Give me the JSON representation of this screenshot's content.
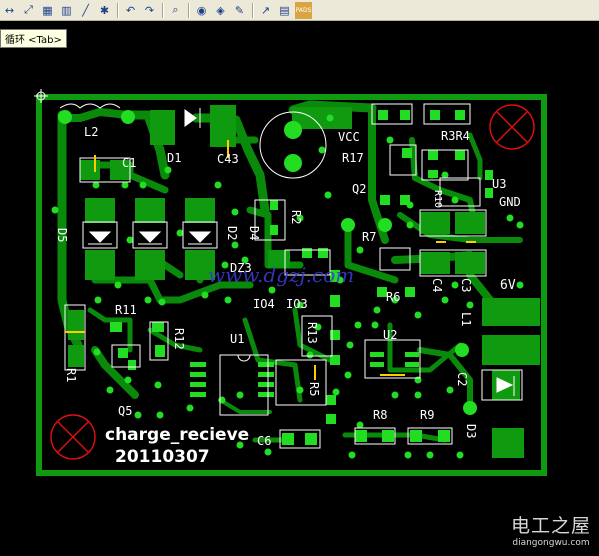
{
  "toolbar": {
    "buttons": [
      {
        "id": "toolbar-button-pan",
        "glyph": "↔"
      },
      {
        "id": "toolbar-button-route",
        "glyph": "⤢"
      },
      {
        "id": "toolbar-button-fill",
        "glyph": "▦"
      },
      {
        "id": "toolbar-button-component",
        "glyph": "▥"
      },
      {
        "id": "toolbar-button-line",
        "glyph": "╱"
      },
      {
        "id": "toolbar-button-via",
        "glyph": "✱"
      },
      {
        "id": "toolbar-button-undo",
        "glyph": "↶"
      },
      {
        "id": "toolbar-button-redo",
        "glyph": "↷"
      },
      {
        "id": "toolbar-button-zoom",
        "glyph": "⌕"
      },
      {
        "id": "toolbar-button-view",
        "glyph": "◉"
      },
      {
        "id": "toolbar-button-highlight",
        "glyph": "◈"
      },
      {
        "id": "toolbar-button-paint",
        "glyph": "✎"
      },
      {
        "id": "toolbar-button-open",
        "glyph": "↗"
      },
      {
        "id": "toolbar-button-layers",
        "glyph": "▤"
      },
      {
        "id": "toolbar-button-pads",
        "glyph": "PADS"
      }
    ]
  },
  "tooltip": {
    "text": "循环 <Tab>"
  },
  "board": {
    "refdes": [
      {
        "id": "L2",
        "text": "L2"
      },
      {
        "id": "C1",
        "text": "C1"
      },
      {
        "id": "D1",
        "text": "D1"
      },
      {
        "id": "C43",
        "text": "C43"
      },
      {
        "id": "VCC",
        "text": "VCC"
      },
      {
        "id": "R17",
        "text": "R17"
      },
      {
        "id": "R3R4",
        "text": "R3R4"
      },
      {
        "id": "Q2",
        "text": "Q2"
      },
      {
        "id": "R10",
        "text": "R10"
      },
      {
        "id": "U3",
        "text": "U3"
      },
      {
        "id": "GND",
        "text": "GND"
      },
      {
        "id": "D5",
        "text": "D5"
      },
      {
        "id": "D2",
        "text": "D2"
      },
      {
        "id": "D4",
        "text": "D4"
      },
      {
        "id": "R2",
        "text": "R2"
      },
      {
        "id": "R7",
        "text": "R7"
      },
      {
        "id": "DZ3",
        "text": "DZ3"
      },
      {
        "id": "C4",
        "text": "C4"
      },
      {
        "id": "C3",
        "text": "C3"
      },
      {
        "id": "6V",
        "text": "6V"
      },
      {
        "id": "R6",
        "text": "R6"
      },
      {
        "id": "R11",
        "text": "R11"
      },
      {
        "id": "R12",
        "text": "R12"
      },
      {
        "id": "IO4",
        "text": "IO4"
      },
      {
        "id": "IO3",
        "text": "IO3"
      },
      {
        "id": "L1",
        "text": "L1"
      },
      {
        "id": "U2",
        "text": "U2"
      },
      {
        "id": "R13",
        "text": "R13"
      },
      {
        "id": "U1",
        "text": "U1"
      },
      {
        "id": "R1",
        "text": "R1"
      },
      {
        "id": "R5",
        "text": "R5"
      },
      {
        "id": "C2",
        "text": "C2"
      },
      {
        "id": "Q5",
        "text": "Q5"
      },
      {
        "id": "R8",
        "text": "R8"
      },
      {
        "id": "R9",
        "text": "R9"
      },
      {
        "id": "D3",
        "text": "D3"
      },
      {
        "id": "C6",
        "text": "C6"
      }
    ],
    "silk_title": "charge_recieve",
    "silk_date": "20110307",
    "overlay_watermark": "www.dgzj.com"
  },
  "watermark": {
    "zh": "电工之屋",
    "en": "diangongwu.com"
  },
  "colors": {
    "trace": "#0a8a0a",
    "copper": "#0f9a0f",
    "pad": "#22dd22",
    "via": "#22dd22",
    "silk": "#ffffff",
    "mark": "#e01010",
    "overlay_text": "#3a3ad0",
    "background": "#000000"
  }
}
